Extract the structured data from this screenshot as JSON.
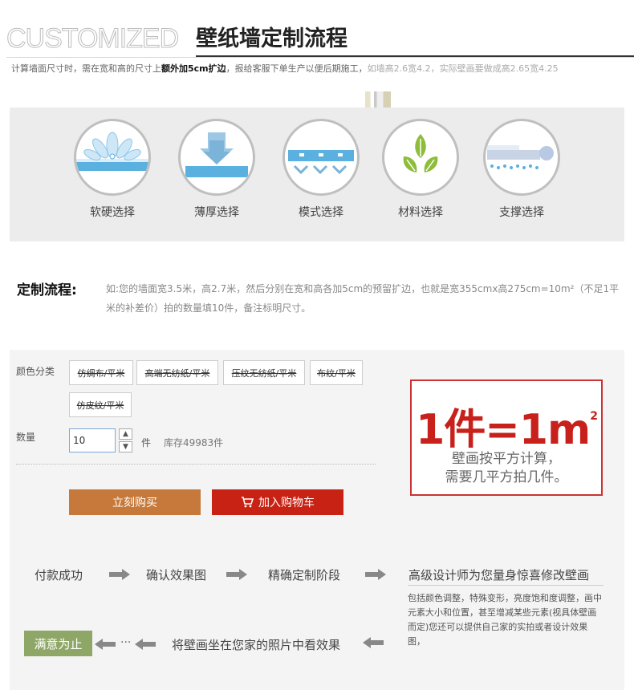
{
  "header": {
    "title_en": "CUSTOMIZED",
    "title_cn": "壁纸墙定制流程",
    "subtitle_pre": "计算墙面尺寸时，需在宽和高的尺寸上",
    "subtitle_bold": "额外加5cm扩边",
    "subtitle_mid": "，报给客服下单生产以便后期施工，",
    "subtitle_light": "如墙高2.6宽4.2，实际壁画要做成高2.65宽4.25"
  },
  "features": [
    {
      "label": "软硬选择",
      "icon": "lotus-softness-icon"
    },
    {
      "label": "薄厚选择",
      "icon": "thickness-arrow-icon"
    },
    {
      "label": "模式选择",
      "icon": "pattern-mode-icon"
    },
    {
      "label": "材料选择",
      "icon": "leaves-material-icon"
    },
    {
      "label": "支撑选择",
      "icon": "support-icon"
    }
  ],
  "process": {
    "title": "定制流程:",
    "text": "如:您的墙面宽3.5米，高2.7米，然后分别在宽和高各加5cm的预留扩边，也就是宽355cmx高275cm=10m²（不足1平米的补差价）拍的数量填10件，备注标明尺寸。"
  },
  "purchase": {
    "color_label": "颜色分类",
    "options": [
      "仿绸布/平米",
      "高端无纺纸/平米",
      "压纹无纺纸/平米",
      "布纹/平米",
      "仿皮纹/平米"
    ],
    "qty_label": "数量",
    "qty_value": "10",
    "unit": "件",
    "stock": "库存49983件",
    "buy_label": "立刻购买",
    "cart_label": "加入购物车"
  },
  "promo": {
    "big": "1件=1m",
    "sup": "2",
    "line1": "壁画按平方计算，",
    "line2": "需要几平方拍几件。"
  },
  "flow": {
    "s1": "付款成功",
    "s2": "确认效果图",
    "s3": "精确定制阶段",
    "s4": "高级设计师为您量身惊喜修改壁画",
    "note": "包括颜色调整，特殊变形，亮度饱和度调整，画中元素大小和位置，甚至增减某些元素(视具体壁画而定)您还可以提供自己家的实拍或者设计效果图，",
    "s5": "将壁画坐在您家的照片中看效果",
    "ellipsis": "···",
    "s6": "满意为止"
  },
  "colors": {
    "buy": "#c6793a",
    "cart": "#c82214",
    "promo_red": "#c8201a",
    "ok_green": "#8fa766"
  }
}
